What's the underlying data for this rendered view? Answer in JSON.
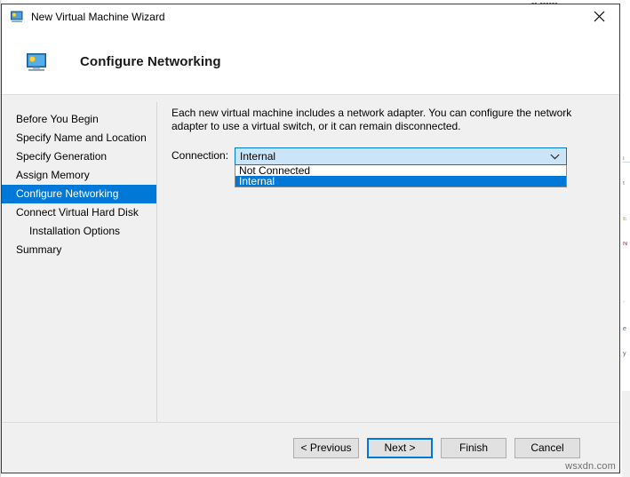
{
  "window": {
    "title": "New Virtual Machine Wizard",
    "title_icon": "virtual-machine-icon",
    "close_icon": "close-icon"
  },
  "header": {
    "title": "Configure Networking",
    "icon": "networking-monitor-icon"
  },
  "sidebar": {
    "items": [
      {
        "label": "Before You Begin",
        "selected": false,
        "indented": false
      },
      {
        "label": "Specify Name and Location",
        "selected": false,
        "indented": false
      },
      {
        "label": "Specify Generation",
        "selected": false,
        "indented": false
      },
      {
        "label": "Assign Memory",
        "selected": false,
        "indented": false
      },
      {
        "label": "Configure Networking",
        "selected": true,
        "indented": false
      },
      {
        "label": "Connect Virtual Hard Disk",
        "selected": false,
        "indented": false
      },
      {
        "label": "Installation Options",
        "selected": false,
        "indented": true
      },
      {
        "label": "Summary",
        "selected": false,
        "indented": false
      }
    ]
  },
  "content": {
    "intro_text": "Each new virtual machine includes a network adapter. You can configure the network adapter to use a virtual switch, or it can remain disconnected.",
    "connection_label": "Connection:",
    "connection_value": "Internal",
    "connection_dropdown_icon": "chevron-down-icon",
    "connection_options": [
      {
        "label": "Not Connected",
        "highlight": false
      },
      {
        "label": "Internal",
        "highlight": true
      }
    ]
  },
  "footer": {
    "buttons": [
      {
        "label": "< Previous",
        "focused": false
      },
      {
        "label": "Next >",
        "focused": true
      },
      {
        "label": "Finish",
        "focused": false
      },
      {
        "label": "Cancel",
        "focused": false
      }
    ]
  },
  "watermark": {
    "text": "wsxdn.com"
  },
  "background": {
    "top_title": "▪▪ ▪▪▪▪▪▪"
  },
  "colors": {
    "accent": "#0078d7",
    "combo_fill": "#cce4f7",
    "panel": "#f0f0f0",
    "button_face": "#e1e1e1"
  }
}
